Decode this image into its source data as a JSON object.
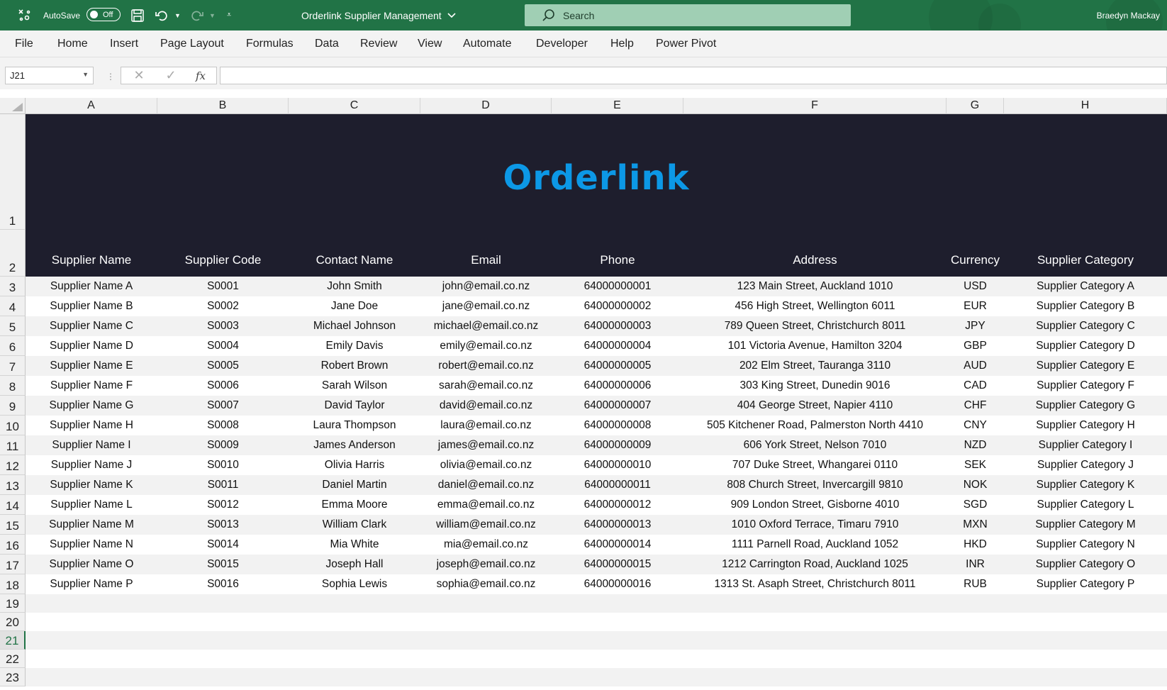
{
  "titlebar": {
    "autosave_label": "AutoSave",
    "autosave_state": "Off",
    "document_title": "Orderlink Supplier Management",
    "search_placeholder": "Search",
    "user_name": "Braedyn Mackay",
    "accent_color": "#217346"
  },
  "ribbon": {
    "tabs": [
      "File",
      "Home",
      "Insert",
      "Page Layout",
      "Formulas",
      "Data",
      "Review",
      "View",
      "Automate",
      "Developer",
      "Help",
      "Power Pivot"
    ]
  },
  "formula_bar": {
    "name_box": "J21",
    "formula": ""
  },
  "columns": [
    "A",
    "B",
    "C",
    "D",
    "E",
    "F",
    "G",
    "H"
  ],
  "rows": [
    "1",
    "2",
    "3",
    "4",
    "5",
    "6",
    "7",
    "8",
    "9",
    "10",
    "11",
    "12",
    "13",
    "14",
    "15",
    "16",
    "17",
    "18",
    "19",
    "20",
    "21",
    "22",
    "23"
  ],
  "selected_row": "21",
  "sheet": {
    "brand": "Orderlink",
    "banner_color": "#1e1e2d",
    "brand_color": "#0c98e6",
    "headers": [
      "Supplier Name",
      "Supplier Code",
      "Contact Name",
      "Email",
      "Phone",
      "Address",
      "Currency",
      "Supplier Category"
    ],
    "records": [
      [
        "Supplier Name A",
        "S0001",
        "John Smith",
        "john@email.co.nz",
        "64000000001",
        "123 Main Street, Auckland 1010",
        "USD",
        "Supplier Category A"
      ],
      [
        "Supplier Name B",
        "S0002",
        "Jane Doe",
        "jane@email.co.nz",
        "64000000002",
        "456 High Street, Wellington 6011",
        "EUR",
        "Supplier Category B"
      ],
      [
        "Supplier Name C",
        "S0003",
        "Michael Johnson",
        "michael@email.co.nz",
        "64000000003",
        "789 Queen Street, Christchurch 8011",
        "JPY",
        "Supplier Category C"
      ],
      [
        "Supplier Name D",
        "S0004",
        "Emily Davis",
        "emily@email.co.nz",
        "64000000004",
        "101 Victoria Avenue, Hamilton 3204",
        "GBP",
        "Supplier Category D"
      ],
      [
        "Supplier Name E",
        "S0005",
        "Robert Brown",
        "robert@email.co.nz",
        "64000000005",
        "202 Elm Street, Tauranga 3110",
        "AUD",
        "Supplier Category E"
      ],
      [
        "Supplier Name F",
        "S0006",
        "Sarah Wilson",
        "sarah@email.co.nz",
        "64000000006",
        "303 King Street, Dunedin 9016",
        "CAD",
        "Supplier Category F"
      ],
      [
        "Supplier Name G",
        "S0007",
        "David Taylor",
        "david@email.co.nz",
        "64000000007",
        "404 George Street, Napier 4110",
        "CHF",
        "Supplier Category G"
      ],
      [
        "Supplier Name H",
        "S0008",
        "Laura Thompson",
        "laura@email.co.nz",
        "64000000008",
        "505 Kitchener Road, Palmerston North 4410",
        "CNY",
        "Supplier Category H"
      ],
      [
        "Supplier Name I",
        "S0009",
        "James Anderson",
        "james@email.co.nz",
        "64000000009",
        "606 York Street, Nelson 7010",
        "NZD",
        "Supplier Category I"
      ],
      [
        "Supplier Name J",
        "S0010",
        "Olivia Harris",
        "olivia@email.co.nz",
        "64000000010",
        "707 Duke Street, Whangarei 0110",
        "SEK",
        "Supplier Category J"
      ],
      [
        "Supplier Name K",
        "S0011",
        "Daniel Martin",
        "daniel@email.co.nz",
        "64000000011",
        "808 Church Street, Invercargill 9810",
        "NOK",
        "Supplier Category K"
      ],
      [
        "Supplier Name L",
        "S0012",
        "Emma Moore",
        "emma@email.co.nz",
        "64000000012",
        "909 London Street, Gisborne 4010",
        "SGD",
        "Supplier Category L"
      ],
      [
        "Supplier Name M",
        "S0013",
        "William Clark",
        "william@email.co.nz",
        "64000000013",
        "1010 Oxford Terrace, Timaru 7910",
        "MXN",
        "Supplier Category M"
      ],
      [
        "Supplier Name N",
        "S0014",
        "Mia White",
        "mia@email.co.nz",
        "64000000014",
        "1111 Parnell Road, Auckland 1052",
        "HKD",
        "Supplier Category N"
      ],
      [
        "Supplier Name O",
        "S0015",
        "Joseph Hall",
        "joseph@email.co.nz",
        "64000000015",
        "1212 Carrington Road, Auckland 1025",
        "INR",
        "Supplier Category O"
      ],
      [
        "Supplier Name P",
        "S0016",
        "Sophia Lewis",
        "sophia@email.co.nz",
        "64000000016",
        "1313 St. Asaph Street, Christchurch 8011",
        "RUB",
        "Supplier Category P"
      ]
    ]
  }
}
